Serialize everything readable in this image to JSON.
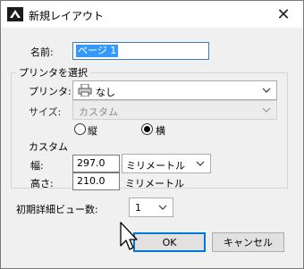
{
  "window": {
    "title": "新規レイアウト",
    "close_glyph": "✕"
  },
  "name": {
    "label": "名前:",
    "value": "ページ 1"
  },
  "printer_group": {
    "title": "プリンタを選択",
    "printer_label": "プリンタ:",
    "printer_value": "なし",
    "size_label": "サイズ:",
    "size_value": "カスタム",
    "orientation": {
      "portrait": "縦",
      "landscape": "横",
      "selected": "landscape"
    },
    "custom_label": "カスタム",
    "width_label": "幅:",
    "width_value": "297.0",
    "width_unit": "ミリメートル",
    "height_label": "高さ:",
    "height_value": "210.0",
    "height_unit": "ミリメートル"
  },
  "detail_views": {
    "label": "初期詳細ビュー数:",
    "value": "1"
  },
  "buttons": {
    "ok": "OK",
    "cancel": "キャンセル"
  },
  "icons": {
    "app": "app-logo-icon",
    "close": "close-icon",
    "printer": "printer-icon",
    "dropdown": "chevron-down-icon",
    "cursor": "mouse-pointer-icon"
  }
}
